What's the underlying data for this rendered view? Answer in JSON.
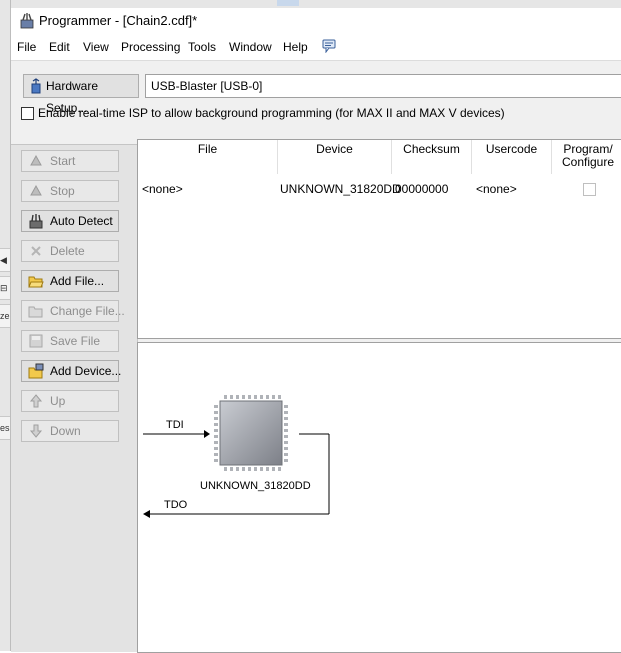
{
  "window": {
    "title": "Programmer - [Chain2.cdf]*"
  },
  "menu": [
    "File",
    "Edit",
    "View",
    "Processing",
    "Tools",
    "Window",
    "Help"
  ],
  "hardware": {
    "button_label": "Hardware Setup...",
    "value": "USB-Blaster [USB-0]"
  },
  "isp": {
    "checked": false,
    "label": "Enable real-time ISP to allow background programming (for MAX II and MAX V devices)"
  },
  "toolbar": {
    "start": "Start",
    "stop": "Stop",
    "auto_detect": "Auto Detect",
    "delete": "Delete",
    "add_file": "Add File...",
    "change_file": "Change File...",
    "save_file": "Save File",
    "add_device": "Add Device...",
    "up": "Up",
    "down": "Down"
  },
  "table": {
    "headers": {
      "file": "File",
      "device": "Device",
      "checksum": "Checksum",
      "usercode": "Usercode",
      "program_1": "Program/",
      "program_2": "Configure"
    },
    "rows": [
      {
        "file": "<none>",
        "device": "UNKNOWN_31820DD",
        "checksum": "00000000",
        "usercode": "<none>",
        "program": false
      }
    ]
  },
  "chain": {
    "device_label": "UNKNOWN_31820DD",
    "tdi": "TDI",
    "tdo": "TDO"
  },
  "background_window": {
    "fragments": [
      "ze",
      "es"
    ]
  },
  "colors": {
    "window_bg": "#f0f0f0",
    "panel_bg": "#ffffff",
    "button_bg": "#e1e1e1",
    "disabled_text": "#8d8d8d"
  }
}
